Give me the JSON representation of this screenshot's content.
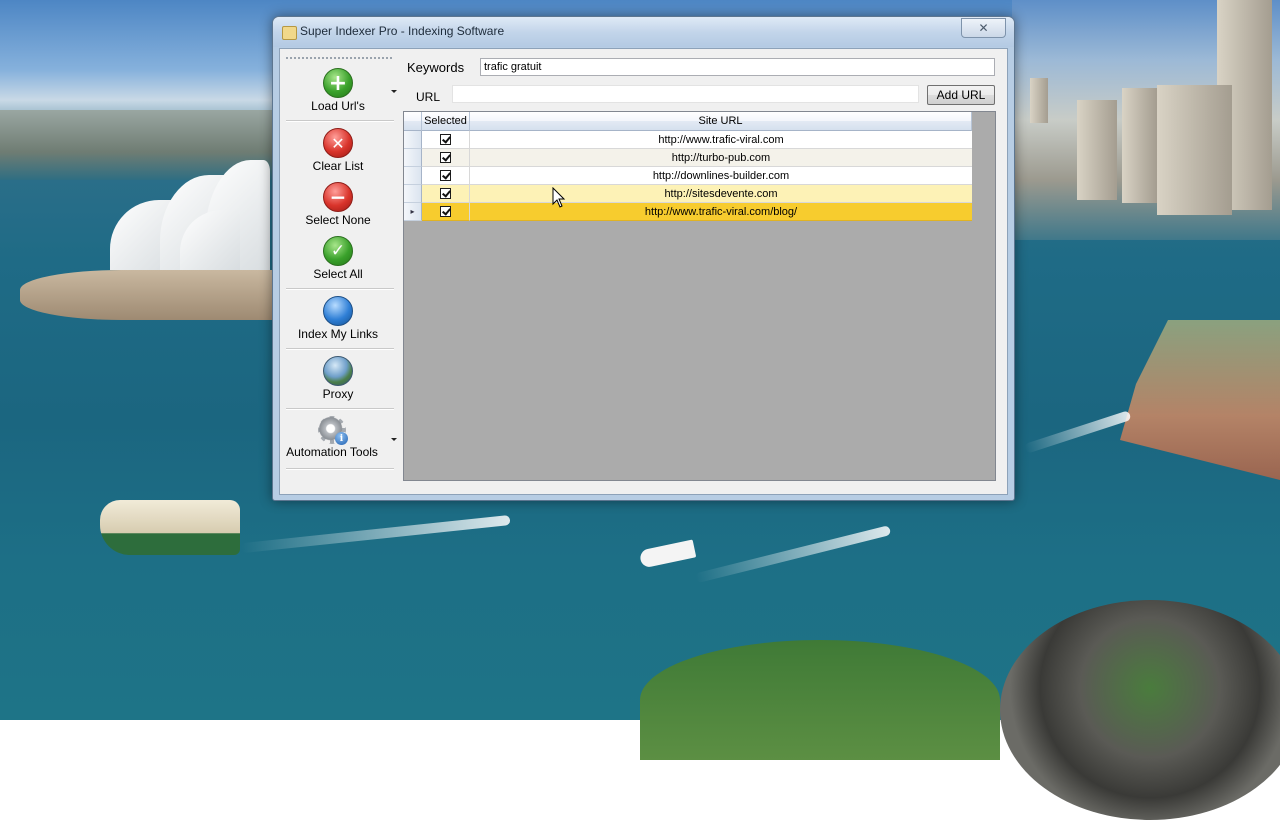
{
  "window": {
    "title": "Super Indexer Pro - Indexing Software",
    "close_label": "✕"
  },
  "toolbar": {
    "items": [
      {
        "label": "Load Url's",
        "icon": "plus-icon"
      },
      {
        "label": "Clear List",
        "icon": "clear-x-icon"
      },
      {
        "label": "Select None",
        "icon": "minus-icon"
      },
      {
        "label": "Select All",
        "icon": "checkmark-icon"
      },
      {
        "label": "Index My Links",
        "icon": "blue-orb-icon"
      },
      {
        "label": "Proxy",
        "icon": "globe-icon"
      },
      {
        "label": "Automation Tools",
        "icon": "gear-info-icon"
      }
    ]
  },
  "keywords": {
    "label": "Keywords",
    "value": "trafic gratuit"
  },
  "url": {
    "label": "URL",
    "value": "",
    "add_button": "Add URL"
  },
  "grid": {
    "columns": [
      "Selected",
      "Site URL"
    ],
    "rows": [
      {
        "selected": true,
        "url": "http://www.trafic-viral.com",
        "state": "white"
      },
      {
        "selected": true,
        "url": "http://turbo-pub.com",
        "state": "alt"
      },
      {
        "selected": true,
        "url": "http://downlines-builder.com",
        "state": "white"
      },
      {
        "selected": true,
        "url": "http://sitesdevente.com",
        "state": "hover"
      },
      {
        "selected": true,
        "url": "http://www.trafic-viral.com/blog/",
        "state": "selected",
        "current": true
      }
    ],
    "current_row_marker": "▸"
  },
  "colors": {
    "selected_row": "#f7cc2e",
    "hover_row": "#fdf2b6",
    "grid_background": "#ababab"
  }
}
